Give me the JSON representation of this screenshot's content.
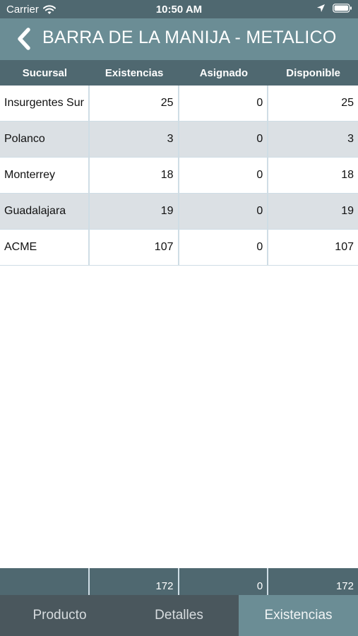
{
  "status_bar": {
    "carrier": "Carrier",
    "time": "10:50 AM",
    "wifi_icon": "wifi-icon",
    "location_icon": "location-arrow-icon",
    "battery_icon": "battery-icon"
  },
  "header": {
    "back_icon": "chevron-left-icon",
    "title": "BARRA DE LA MANIJA - METALICO"
  },
  "table": {
    "columns": [
      "Sucursal",
      "Existencias",
      "Asignado",
      "Disponible"
    ],
    "rows": [
      [
        "Insurgentes Sur",
        "25",
        "0",
        "25"
      ],
      [
        "Polanco",
        "3",
        "0",
        "3"
      ],
      [
        "Monterrey",
        "18",
        "0",
        "18"
      ],
      [
        "Guadalajara",
        "19",
        "0",
        "19"
      ],
      [
        "ACME",
        "107",
        "0",
        "107"
      ]
    ],
    "totals": [
      "",
      "172",
      "0",
      "172"
    ]
  },
  "tabs": [
    {
      "label": "Producto",
      "active": false
    },
    {
      "label": "Detalles",
      "active": false
    },
    {
      "label": "Existencias",
      "active": true
    }
  ],
  "colors": {
    "header_dark": "#4f6870",
    "header_light": "#6b8d95",
    "row_alt": "#dbe0e4",
    "tabbar": "#4a575d"
  }
}
